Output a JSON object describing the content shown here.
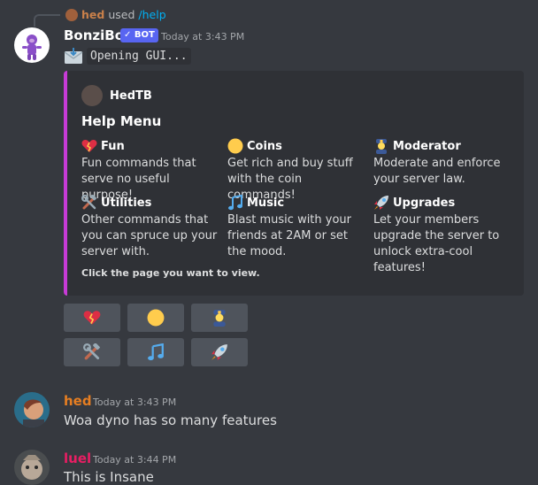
{
  "reply": {
    "user": "hed",
    "used_text": "used",
    "command": "/help"
  },
  "bot_message": {
    "author": "BonziBot",
    "badge": "✓ BOT",
    "timestamp": "Today at 3:43 PM",
    "content": "Opening GUI...",
    "embed": {
      "author": "HedTB",
      "title": "Help Menu",
      "accent_color": "#c73bd6",
      "fields": [
        {
          "icon": "heart-broken-icon",
          "name": "Fun",
          "value": "Fun commands that serve no useful purpose!"
        },
        {
          "icon": "coin-icon",
          "name": "Coins",
          "value": "Get rich and buy stuff with the coin commands!"
        },
        {
          "icon": "police-officer-icon",
          "name": "Moderator",
          "value": "Moderate and enforce your server law."
        },
        {
          "icon": "tools-icon",
          "name": "Utilities",
          "value": "Other commands that you can spruce up your server with."
        },
        {
          "icon": "music-note-icon",
          "name": "Music",
          "value": "Blast music with your friends at 2AM or set the mood."
        },
        {
          "icon": "rocket-icon",
          "name": "Upgrades",
          "value": "Let your members upgrade the server to unlock extra-cool features!"
        }
      ],
      "footer": "Click the page you want to view."
    },
    "buttons": [
      {
        "icon": "heart-broken-icon"
      },
      {
        "icon": "coin-icon"
      },
      {
        "icon": "police-officer-icon"
      },
      {
        "icon": "tools-icon"
      },
      {
        "icon": "music-note-icon"
      },
      {
        "icon": "rocket-icon"
      }
    ]
  },
  "messages": [
    {
      "author": "hed",
      "color": "#e67e22",
      "timestamp": "Today at 3:43 PM",
      "content": "Woa dyno has so many features"
    },
    {
      "author": "luel",
      "color": "#e91e63",
      "timestamp": "Today at 3:44 PM",
      "content": "This is Insane"
    }
  ],
  "colors": {
    "background": "#36393f",
    "embed_bg": "#2f3136",
    "button_bg": "#4f545c",
    "bot_badge": "#5865f2"
  }
}
